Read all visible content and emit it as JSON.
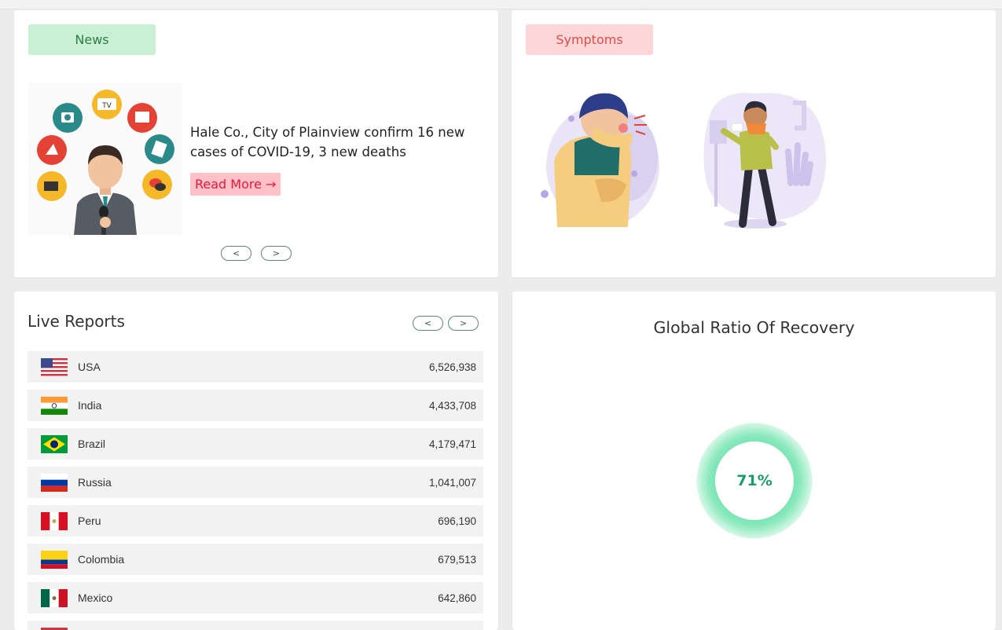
{
  "news": {
    "tag": "News",
    "headline": "Hale Co., City of Plainview confirm 16 new cases of COVID-19, 3 new deaths",
    "read_more": "Read More →",
    "prev": "<",
    "next": ">",
    "illustration_labels": {
      "tv": "TV"
    }
  },
  "symptoms": {
    "tag": "Symptoms"
  },
  "live_reports": {
    "title": "Live Reports",
    "prev": "<",
    "next": ">",
    "rows": [
      {
        "country": "USA",
        "count": "6,526,938",
        "flag": "usa"
      },
      {
        "country": "India",
        "count": "4,433,708",
        "flag": "india"
      },
      {
        "country": "Brazil",
        "count": "4,179,471",
        "flag": "brazil"
      },
      {
        "country": "Russia",
        "count": "1,041,007",
        "flag": "russia"
      },
      {
        "country": "Peru",
        "count": "696,190",
        "flag": "peru"
      },
      {
        "country": "Colombia",
        "count": "679,513",
        "flag": "colombia"
      },
      {
        "country": "Mexico",
        "count": "642,860",
        "flag": "mexico"
      }
    ]
  },
  "recovery": {
    "title": "Global Ratio Of Recovery",
    "percent_label": "71%",
    "ratio": 0.71,
    "color": "#1a9e68"
  }
}
